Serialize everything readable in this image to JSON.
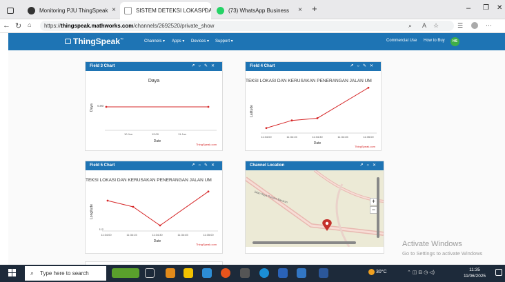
{
  "tabs": [
    {
      "label": "Monitoring PJU ThingSpeak",
      "close": "×"
    },
    {
      "label": "SISTEM DETEKSI LOKASI DAN KE",
      "close": "×"
    },
    {
      "label": "(73) WhatsApp Business",
      "close": "×"
    }
  ],
  "new_tab": "+",
  "address": {
    "scheme": "https://",
    "host": "thingspeak.mathworks.com",
    "path": "/channels/2692520/private_show"
  },
  "window_controls": {
    "minimize": "–",
    "maximize": "❐",
    "close": "✕"
  },
  "nav": {
    "logo": "ThingSpeak",
    "tm": "™",
    "items": [
      "Channels ▾",
      "Apps ▾",
      "Devices ▾",
      "Support ▾"
    ],
    "commercial": "Commercial Use",
    "how_to_buy": "How to Buy",
    "avatar": "HS"
  },
  "cards": {
    "field3": {
      "title": "Field 3 Chart",
      "chart_title": "Daya",
      "ylabel": "Daya",
      "xlabel": "Date",
      "credit": "ThingSpeak.com",
      "ytick": "0.00",
      "xticks": [
        "10 Jun",
        "12:00",
        "11 Jun"
      ]
    },
    "field4": {
      "title": "Field 4 Chart",
      "chart_title": "TEKSI LOKASI DAN KERUSAKAN PENERANGAN JALAN UM",
      "ylabel": "Latitude",
      "xlabel": "Date",
      "credit": "ThingSpeak.com",
      "xticks": [
        "11:34:00",
        "11:34:15",
        "11:34:30",
        "11:34:45",
        "11:35:00"
      ]
    },
    "field5": {
      "title": "Field 5 Chart",
      "chart_title": "TEKSI LOKASI DAN KERUSAKAN PENERANGAN JALAN UM",
      "ylabel": "Longitude",
      "xlabel": "Date",
      "credit": "ThingSpeak.com",
      "ytick": "112",
      "xticks": [
        "11:34:00",
        "11:34:15",
        "11:34:30",
        "11:34:45",
        "11:35:00"
      ]
    },
    "map": {
      "title": "Channel Location",
      "road_label": "Jalan Raya Dungus Basaran"
    }
  },
  "chart_data": [
    {
      "type": "line",
      "title": "Daya",
      "xlabel": "Date",
      "ylabel": "Daya",
      "x": [
        "10 Jun",
        "11 Jun"
      ],
      "values": [
        0,
        0
      ],
      "color": "#d62728"
    },
    {
      "type": "line",
      "title": "TEKSI LOKASI DAN KERUSAKAN PENERANGAN JALAN UM",
      "xlabel": "Date",
      "ylabel": "Latitude",
      "x": [
        "11:34:00",
        "11:34:10",
        "11:34:28",
        "11:34:58"
      ],
      "values": [
        0.05,
        0.22,
        0.27,
        0.95
      ],
      "color": "#d62728"
    },
    {
      "type": "line",
      "title": "TEKSI LOKASI DAN KERUSAKAN PENERANGAN JALAN UM",
      "xlabel": "Date",
      "ylabel": "Longitude",
      "x": [
        "11:34:00",
        "11:34:15",
        "11:34:29",
        "11:35:00"
      ],
      "values": [
        0.7,
        0.55,
        0.1,
        0.92
      ],
      "color": "#d62728"
    }
  ],
  "watermark": {
    "line1": "Activate Windows",
    "line2": "Go to Settings to activate Windows"
  },
  "taskbar": {
    "search_placeholder": "Type here to search",
    "weather": "30°C",
    "time": "11:35",
    "date": "11/06/2025"
  }
}
